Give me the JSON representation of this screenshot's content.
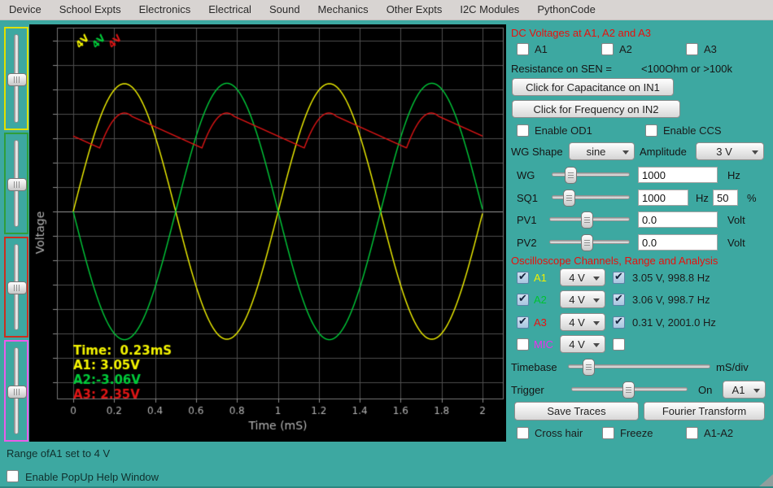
{
  "menu": {
    "items": [
      "Device",
      "School Expts",
      "Electronics",
      "Electrical",
      "Sound",
      "Mechanics",
      "Other Expts",
      "I2C Modules",
      "PythonCode"
    ]
  },
  "left_sliders": [
    {
      "channel": "A1",
      "border_color": "#e0e000",
      "position_pct": 50
    },
    {
      "channel": "A2",
      "border_color": "#2f9e3a",
      "position_pct": 50
    },
    {
      "channel": "A3",
      "border_color": "#cc2e1e",
      "position_pct": 50
    },
    {
      "channel": "MIC",
      "border_color": "#ea5cea",
      "position_pct": 50
    }
  ],
  "panel": {
    "dc_title": "DC Voltages at A1, A2 and A3",
    "dc_checks": [
      {
        "label": "A1",
        "checked": false
      },
      {
        "label": "A2",
        "checked": false
      },
      {
        "label": "A3",
        "checked": false
      }
    ],
    "resistance_label": "Resistance on SEN =",
    "resistance_value": "<100Ohm  or  >100k",
    "capacitance_button": "Click for Capacitance on IN1",
    "frequency_button": "Click for Frequency on IN2",
    "enable_od1": {
      "label": "Enable OD1",
      "checked": false
    },
    "enable_ccs": {
      "label": "Enable CCS",
      "checked": false
    },
    "wg_shape_label": "WG Shape",
    "wg_shape_value": "sine",
    "amplitude_label": "Amplitude",
    "amplitude_value": "3 V",
    "wg": {
      "label": "WG",
      "slider_pct": 23,
      "value": "1000",
      "unit": "Hz"
    },
    "sq1": {
      "label": "SQ1",
      "slider_pct": 21,
      "value": "1000",
      "unit": "Hz",
      "duty": "50",
      "duty_unit": "%"
    },
    "pv1": {
      "label": "PV1",
      "slider_pct": 46,
      "value": "0.0",
      "unit": "Volt"
    },
    "pv2": {
      "label": "PV2",
      "slider_pct": 46,
      "value": "0.0",
      "unit": "Volt"
    },
    "scope_title": "Oscilloscope Channels, Range and Analysis",
    "channels": [
      {
        "label": "A1",
        "color": "#f0f000",
        "enabled": true,
        "range": "4 V",
        "analyze": true,
        "reading": "3.05 V, 998.8 Hz"
      },
      {
        "label": "A2",
        "color": "#00c232",
        "enabled": true,
        "range": "4 V",
        "analyze": true,
        "reading": "3.06 V, 998.7 Hz"
      },
      {
        "label": "A3",
        "color": "#e81212",
        "enabled": true,
        "range": "4 V",
        "analyze": true,
        "reading": "0.31 V, 2001.0 Hz"
      },
      {
        "label": "MIC",
        "color": "#ee2dee",
        "enabled": false,
        "range": "4 V",
        "analyze": false,
        "reading": ""
      }
    ],
    "timebase": {
      "label": "Timebase",
      "slider_pct": 14,
      "unit": "mS/div"
    },
    "trigger": {
      "label": "Trigger",
      "slider_pct": 49,
      "on_label": "On",
      "source": "A1"
    },
    "save_button": "Save Traces",
    "fourier_button": "Fourier Transform",
    "extra_checks": [
      {
        "label": "Cross hair",
        "checked": false
      },
      {
        "label": "Freeze",
        "checked": false
      },
      {
        "label": "A1-A2",
        "checked": false
      }
    ]
  },
  "status": {
    "message": "Range ofA1 set to 4 V",
    "popup_check": {
      "label": "Enable PopUp Help Window",
      "checked": false
    }
  },
  "chart_data": {
    "type": "line",
    "title": "",
    "xlabel": "Time (mS)",
    "ylabel": "Voltage",
    "x_range_ms": [
      0,
      2
    ],
    "y_range_v": [
      -4.4,
      4.4
    ],
    "grid": true,
    "x_ticks": [
      "0",
      "0.2",
      "0.4",
      "0.6",
      "0.8",
      "1",
      "1.2",
      "1.4",
      "1.6",
      "1.8",
      "2"
    ],
    "range_labels": [
      {
        "text": "4V",
        "color": "#f4f400"
      },
      {
        "text": "4V",
        "color": "#00cc3a"
      },
      {
        "text": "4V",
        "color": "#dd1515"
      }
    ],
    "series": [
      {
        "name": "A1",
        "color": "#f4f400",
        "model": "sine",
        "amplitude_v": 3.05,
        "frequency_hz": 998.8,
        "phase_deg": 0
      },
      {
        "name": "A2",
        "color": "#00cc3a",
        "model": "sine",
        "amplitude_v": 3.06,
        "frequency_hz": 998.7,
        "phase_deg": 180
      },
      {
        "name": "A3",
        "color": "#dd1515",
        "model": "rectified_ripple",
        "peak_v": 2.35,
        "ripple_rms_v": 0.31,
        "ripple_frequency_hz": 2001.0,
        "decay_v_per_ms": 2.2,
        "diode_drop_v": 0.7,
        "source_amplitude_v": 3.05
      }
    ],
    "cursor_readout": [
      {
        "text": "Time:  0.23mS",
        "color": "#f4f400"
      },
      {
        "text": "A1: 3.05V",
        "color": "#f4f400"
      },
      {
        "text": "A2:-3.06V",
        "color": "#00cc3a"
      },
      {
        "text": "A3: 2.35V",
        "color": "#dd1515"
      }
    ]
  }
}
